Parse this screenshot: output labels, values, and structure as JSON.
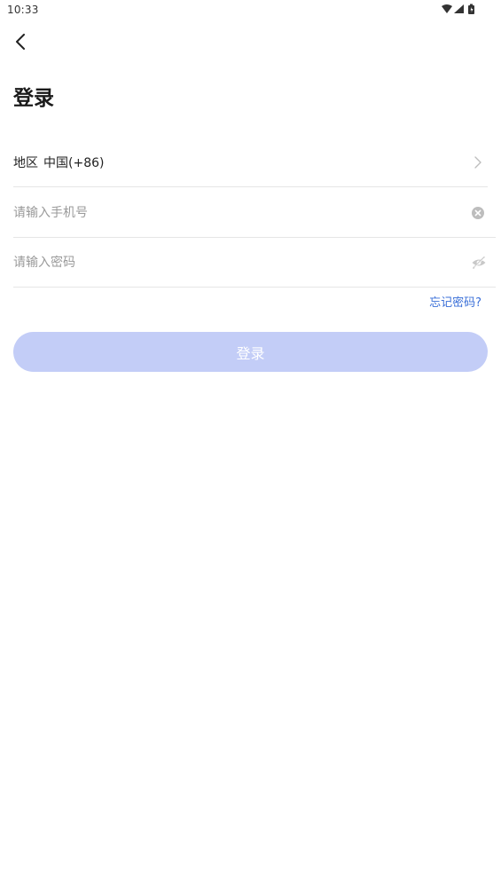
{
  "status_bar": {
    "time": "10:33",
    "icons": [
      "wifi-icon",
      "signal-icon",
      "battery-icon"
    ]
  },
  "header": {
    "back_icon": "chevron-left-icon",
    "title": "登录"
  },
  "form": {
    "region": {
      "label": "地区",
      "value": "中国(+86)",
      "icon": "chevron-right-icon"
    },
    "phone": {
      "value": "",
      "placeholder": "请输入手机号",
      "icon": "clear-icon"
    },
    "password": {
      "value": "",
      "placeholder": "请输入密码",
      "icon": "eye-off-icon"
    },
    "forgot_label": "忘记密码?",
    "login_label": "登录"
  },
  "colors": {
    "accent": "#3a6fd8",
    "button_disabled": "#c3cdf7",
    "divider": "#e6e6e6",
    "placeholder": "#9a9a9a"
  }
}
